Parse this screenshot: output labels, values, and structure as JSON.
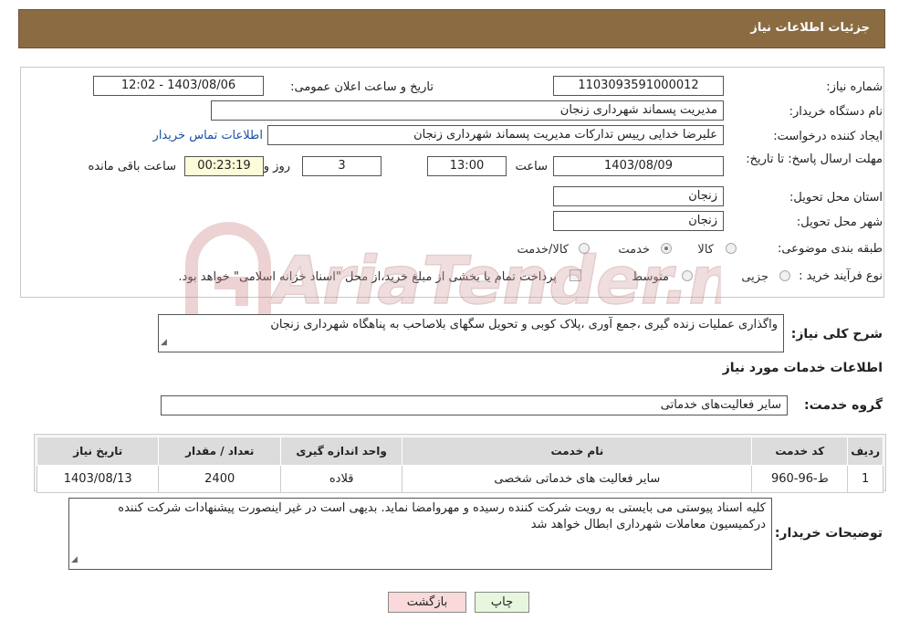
{
  "header": {
    "title": "جزئیات اطلاعات نیاز"
  },
  "form": {
    "need_number_label": "شماره نیاز:",
    "need_number": "1103093591000012",
    "announce_label": "تاریخ و ساعت اعلان عمومی:",
    "announce_value": "1403/08/06 - 12:02",
    "buyer_org_label": "نام دستگاه خریدار:",
    "buyer_org": "مدیریت پسماند شهرداری زنجان",
    "creator_label": "ایجاد کننده درخواست:",
    "creator": "علیرضا خدایی رییس تدارکات مدیریت پسماند شهرداری زنجان",
    "contact_link": "اطلاعات تماس خریدار",
    "deadline_label": "مهلت ارسال پاسخ: تا تاریخ:",
    "deadline_date": "1403/08/09",
    "time_label": "ساعت",
    "deadline_time": "13:00",
    "days_value": "3",
    "days_label": "روز و",
    "remaining_time": "00:23:19",
    "remaining_label": "ساعت باقی مانده",
    "province_label": "استان محل تحویل:",
    "province": "زنجان",
    "city_label": "شهر محل تحویل:",
    "city": "زنجان",
    "category_label": "طبقه بندی موضوعی:",
    "category_options": [
      "کالا",
      "خدمت",
      "کالا/خدمت"
    ],
    "category_selected": "خدمت",
    "process_label": "نوع فرآیند خرید :",
    "process_options": [
      "جزیی",
      "متوسط"
    ],
    "payment_note": "پرداخت تمام یا بخشی از مبلغ خرید،از محل \"اسناد خزانه اسلامی\" خواهد بود."
  },
  "description": {
    "label": "شرح کلی نیاز:",
    "text": "واگذاری عملیات زنده گیری ،جمع آوری ،پلاک کوبی و تحویل سگهای بلاصاحب به پناهگاه شهرداری زنجان"
  },
  "services": {
    "section_title": "اطلاعات خدمات مورد نیاز",
    "group_label": "گروه خدمت:",
    "group_value": "سایر فعالیت‌های خدماتی",
    "columns": [
      "ردیف",
      "کد خدمت",
      "نام خدمت",
      "واحد اندازه گیری",
      "تعداد / مقدار",
      "تاریخ نیاز"
    ],
    "rows": [
      [
        "1",
        "ط-96-960",
        "سایر فعالیت های خدماتی شخصی",
        "قلاده",
        "2400",
        "1403/08/13"
      ]
    ]
  },
  "buyer_notes": {
    "label": "توضیحات خریدار:",
    "text": "کلیه اسناد پیوستی می بایستی به رویت شرکت کننده رسیده و مهروامضا نماید. بدیهی است در غیر اینصورت پیشنهادات شرکت کننده درکمیسیون معاملات شهرداری ابطال خواهد شد"
  },
  "buttons": {
    "print": "چاپ",
    "back": "بازگشت"
  },
  "watermark": {
    "text": "AriaTender.net"
  },
  "colors": {
    "header_bg": "#8b6c42",
    "link": "#1a4fa8",
    "back_btn": "#f9d9d9",
    "print_btn": "#e6f7dd"
  }
}
